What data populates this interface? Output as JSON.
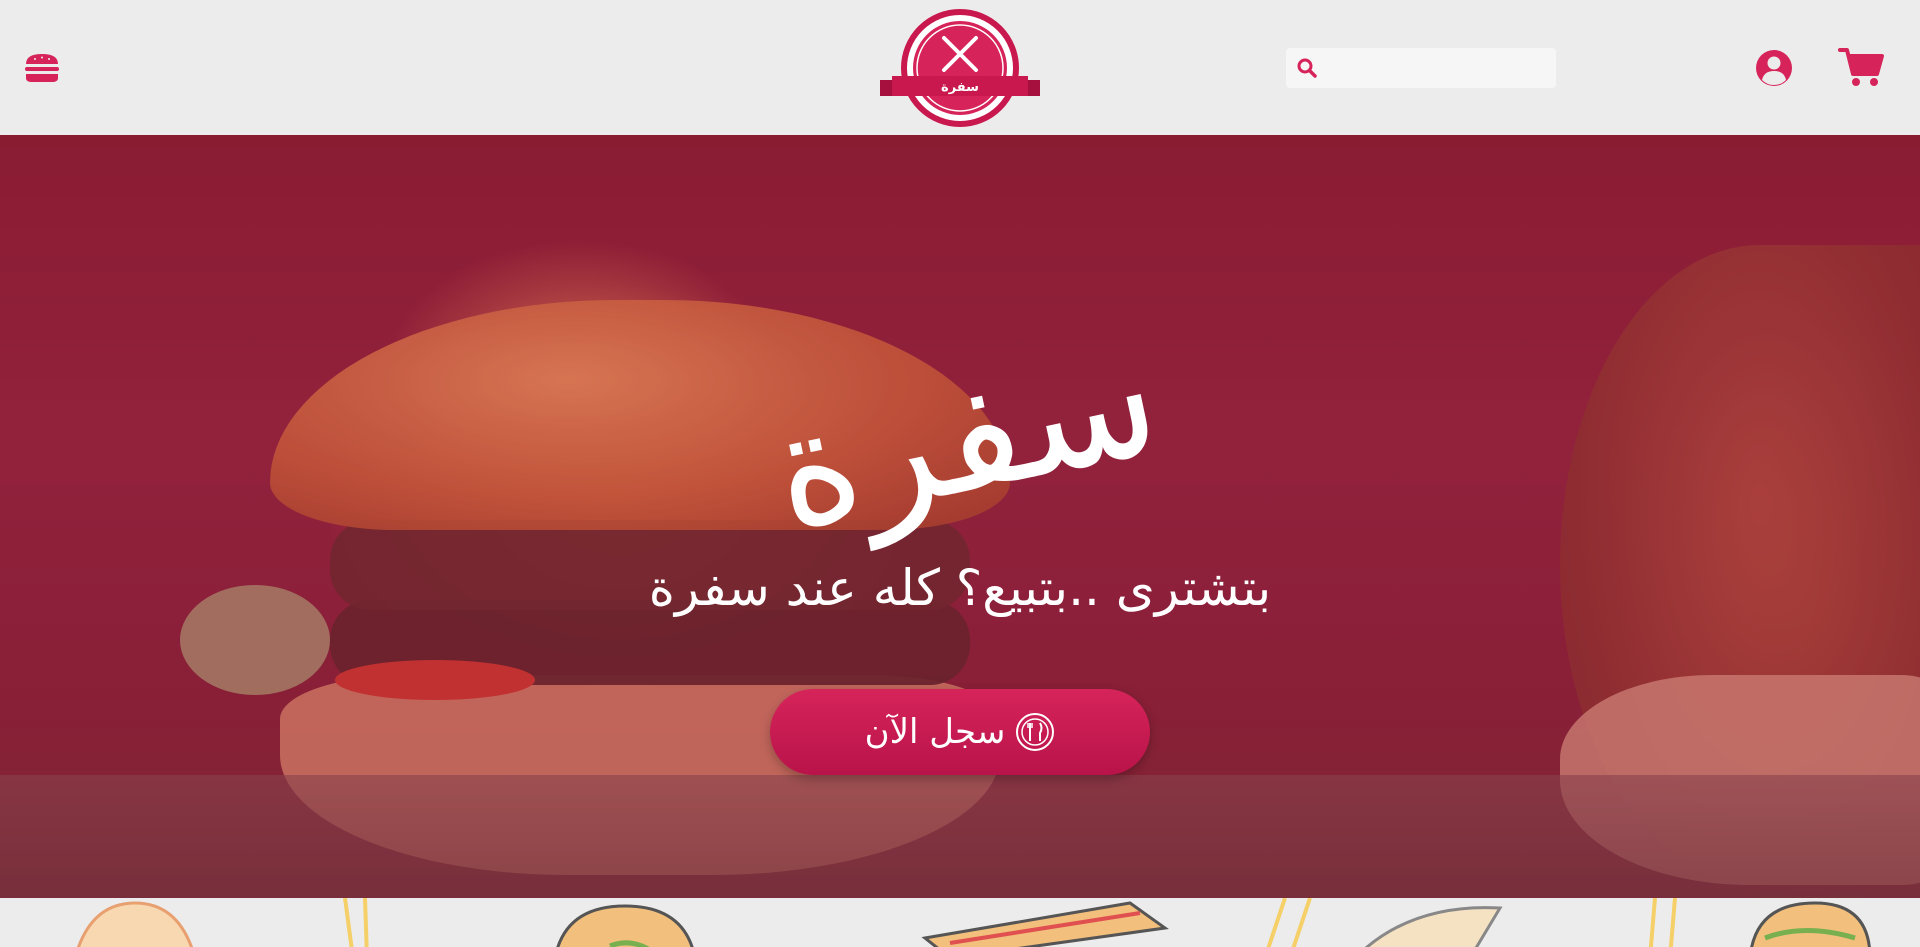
{
  "header": {
    "logo_text": "سفرة",
    "search": {
      "placeholder": "",
      "value": ""
    },
    "icons": {
      "menu": "burger-menu-icon",
      "search": "search-icon",
      "user": "user-circle-icon",
      "cart": "cart-icon"
    }
  },
  "hero": {
    "title": "سفرة",
    "tagline": "بتشترى ..بتبيع؟ كله عند سفرة",
    "cta_label": "سجل الآن"
  },
  "colors": {
    "accent": "#d6245a",
    "accent_dark": "#b8134a",
    "background": "#ececec"
  }
}
